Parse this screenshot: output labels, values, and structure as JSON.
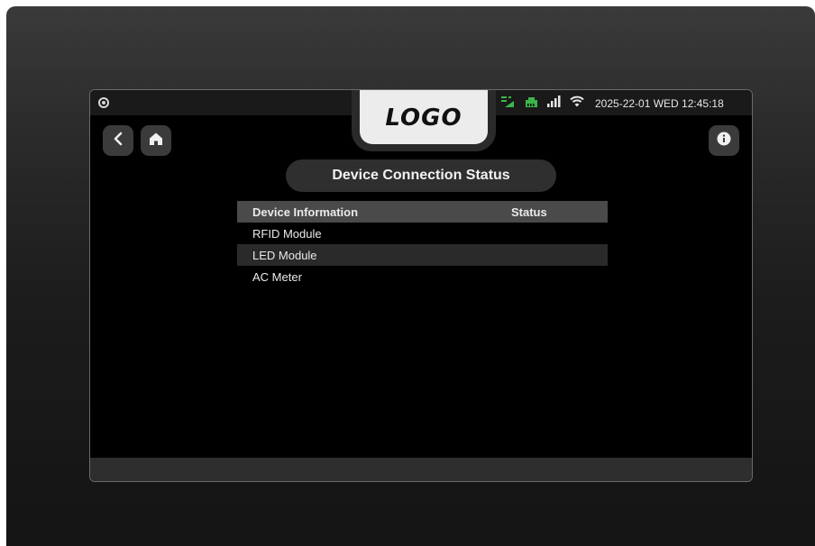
{
  "header": {
    "logo": "LOGO",
    "datetime": "2025-22-01 WED 12:45:18",
    "status_icons": [
      "network-switch-icon",
      "ethernet-icon",
      "cell-signal-icon",
      "wifi-icon"
    ],
    "accent_color": "#3db54a"
  },
  "nav": {
    "back_icon": "chevron-left-icon",
    "home_icon": "home-icon",
    "info_icon": "info-icon"
  },
  "page": {
    "title": "Device Connection Status"
  },
  "table": {
    "headers": {
      "device": "Device Information",
      "status": "Status"
    },
    "rows": [
      {
        "device": "RFID Module",
        "status": ""
      },
      {
        "device": "LED Module",
        "status": ""
      },
      {
        "device": "AC Meter",
        "status": ""
      }
    ]
  }
}
